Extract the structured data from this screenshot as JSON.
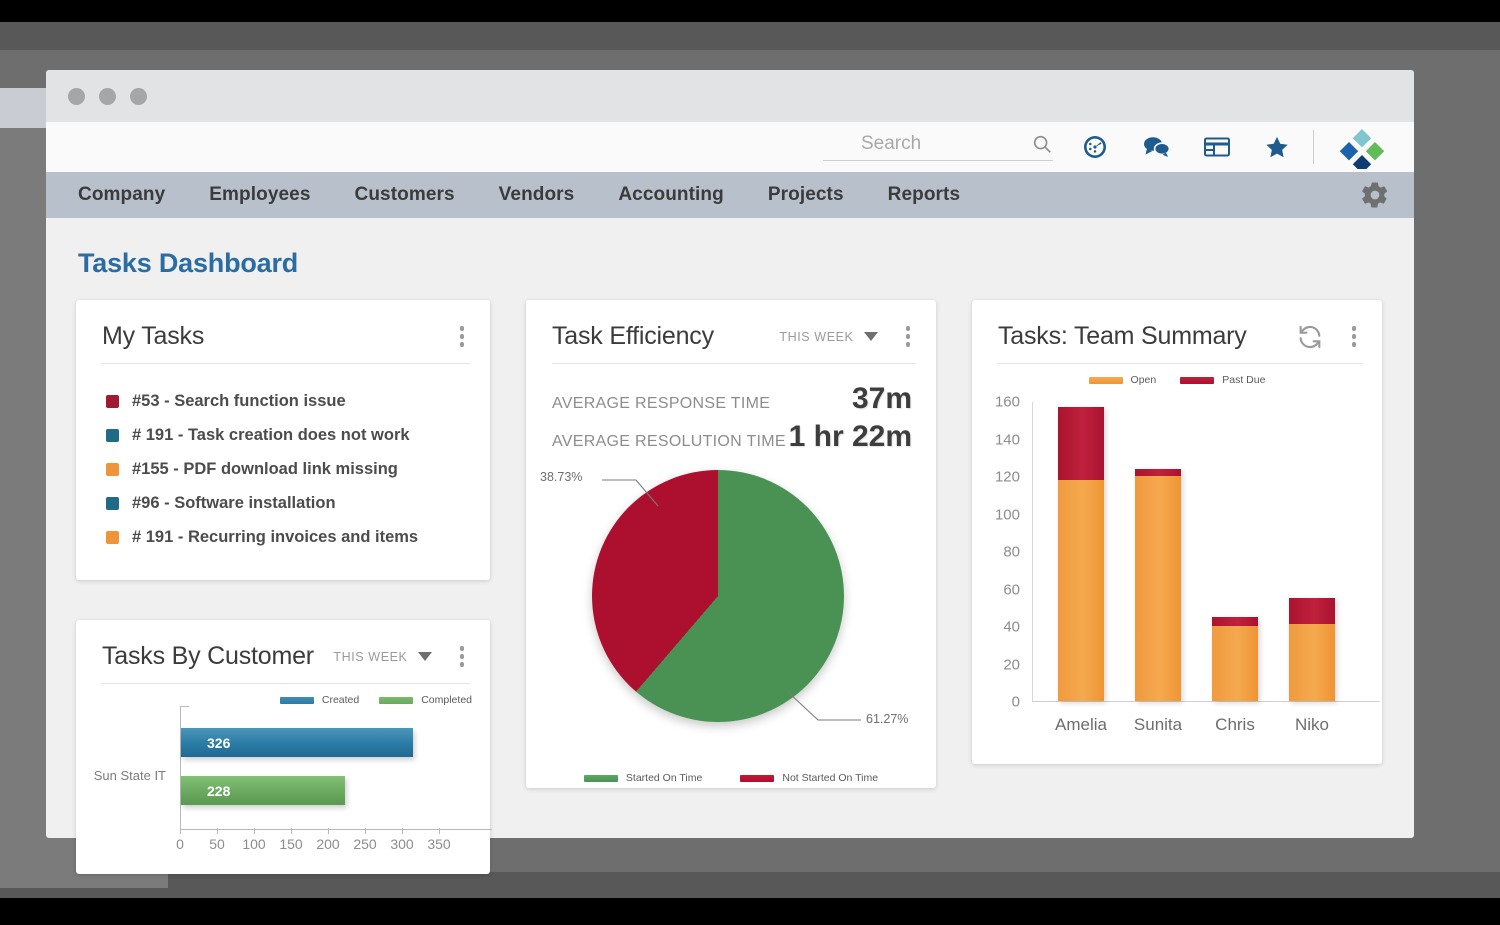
{
  "window": {
    "dots": [
      "close",
      "minimize",
      "maximize"
    ]
  },
  "toolbar": {
    "search_placeholder": "Search",
    "search_value": "",
    "icons": [
      {
        "name": "dashboard-gauge-icon",
        "label": "Dashboard"
      },
      {
        "name": "chat-bubbles-icon",
        "label": "Messages"
      },
      {
        "name": "table-grid-icon",
        "label": "Records"
      },
      {
        "name": "star-icon",
        "label": "Favorites"
      }
    ],
    "logo_name": "app-logo-diamonds"
  },
  "menu": {
    "items": [
      "Company",
      "Employees",
      "Customers",
      "Vendors",
      "Accounting",
      "Projects",
      "Reports"
    ],
    "settings_icon": "gear-icon"
  },
  "page": {
    "title": "Tasks Dashboard"
  },
  "my_tasks": {
    "title": "My Tasks",
    "items": [
      {
        "label": "#53 - Search function issue",
        "color": "#9e1b33"
      },
      {
        "label": "# 191 - Task creation does not work",
        "color": "#1f6b86"
      },
      {
        "label": "#155 - PDF download link missing",
        "color": "#f0943a"
      },
      {
        "label": "#96 - Software installation",
        "color": "#1f6b86"
      },
      {
        "label": "# 191 - Recurring invoices and items",
        "color": "#f0943a"
      }
    ]
  },
  "tasks_by_customer": {
    "title": "Tasks By Customer",
    "period": "THIS WEEK",
    "chart_data": {
      "type": "bar",
      "orientation": "horizontal",
      "categories": [
        "Sun State IT"
      ],
      "series": [
        {
          "name": "Created",
          "values": [
            326
          ],
          "color": "#2b7ba5"
        },
        {
          "name": "Completed",
          "values": [
            228
          ],
          "color": "#6aa95f"
        }
      ],
      "xlabel": "",
      "ylabel": "",
      "xlim": [
        0,
        350
      ],
      "xticks": [
        0,
        50,
        100,
        150,
        200,
        250,
        300,
        350
      ],
      "grid": false,
      "legend_position": "top-right"
    }
  },
  "task_efficiency": {
    "title": "Task Efficiency",
    "period": "THIS WEEK",
    "metrics": [
      {
        "label": "AVERAGE RESPONSE TIME",
        "value": "37m"
      },
      {
        "label": "AVERAGE RESOLUTION TIME",
        "value": "1 hr 22m"
      }
    ],
    "chart_data": {
      "type": "pie",
      "title": "Task Efficiency",
      "labels": [
        "Started On Time",
        "Not Started On Time"
      ],
      "values": [
        61.27,
        38.73
      ],
      "value_labels": [
        "61.27%",
        "38.73%"
      ],
      "colors": [
        "#4a9254",
        "#ad0f2e"
      ],
      "legend_position": "bottom"
    }
  },
  "team_summary": {
    "title": "Tasks: Team Summary",
    "refresh_icon": "refresh-icon",
    "chart_data": {
      "type": "bar",
      "stacked": true,
      "title": "Tasks: Team Summary",
      "categories": [
        "Amelia",
        "Sunita",
        "Chris",
        "Niko"
      ],
      "series": [
        {
          "name": "Open",
          "values": [
            118,
            120,
            40,
            41
          ],
          "color": "#f09a3e"
        },
        {
          "name": "Past Due",
          "values": [
            39,
            4,
            5,
            14
          ],
          "color": "#ad1431"
        }
      ],
      "xlabel": "",
      "ylabel": "",
      "ylim": [
        0,
        160
      ],
      "yticks": [
        0,
        20,
        40,
        60,
        80,
        100,
        120,
        140,
        160
      ],
      "grid": false,
      "legend_position": "top"
    }
  },
  "colors": {
    "accent": "#2b6ca3",
    "menubar": "#b8c0cc",
    "open": "#f09a3e",
    "past_due": "#ad1431",
    "on_time": "#4a9254",
    "not_on_time": "#ad0f2e",
    "created": "#2b7ba5",
    "completed": "#6aa95f"
  }
}
